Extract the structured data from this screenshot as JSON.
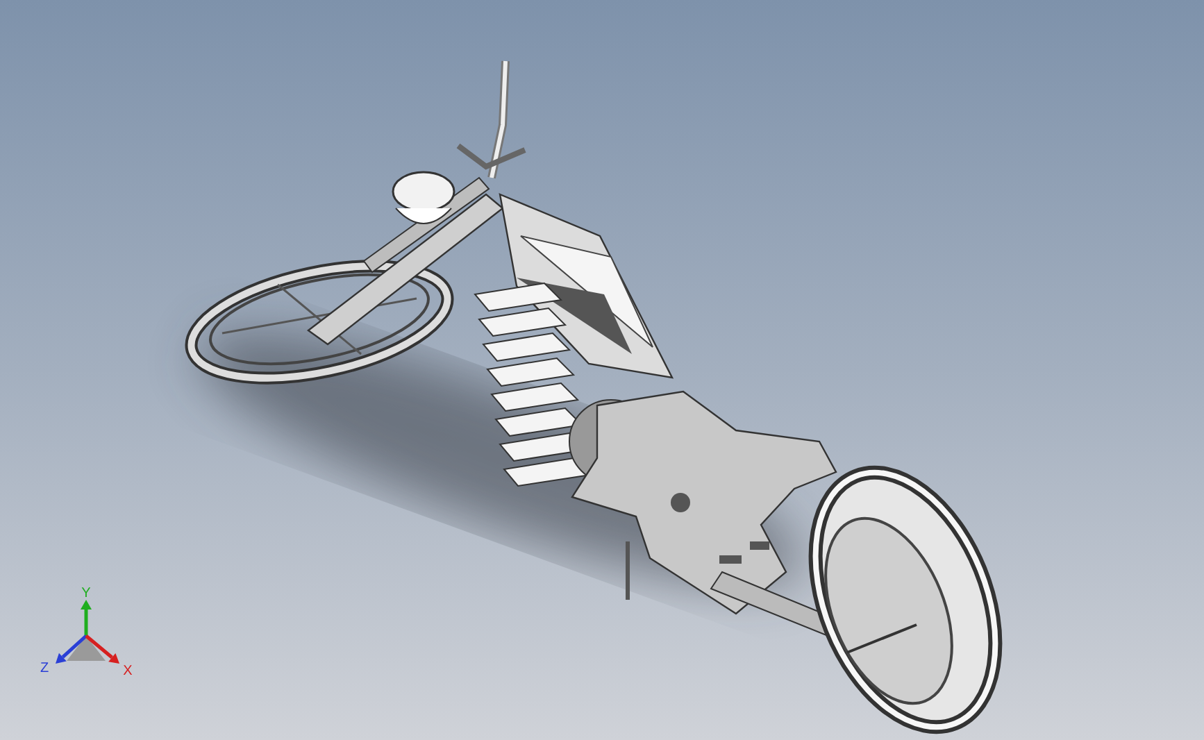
{
  "viewport": {
    "triad": {
      "axes": [
        {
          "label": "Y",
          "color": "#1fae1f"
        },
        {
          "label": "Z",
          "color": "#2a3fd6"
        },
        {
          "label": "X",
          "color": "#d62020"
        }
      ]
    }
  }
}
